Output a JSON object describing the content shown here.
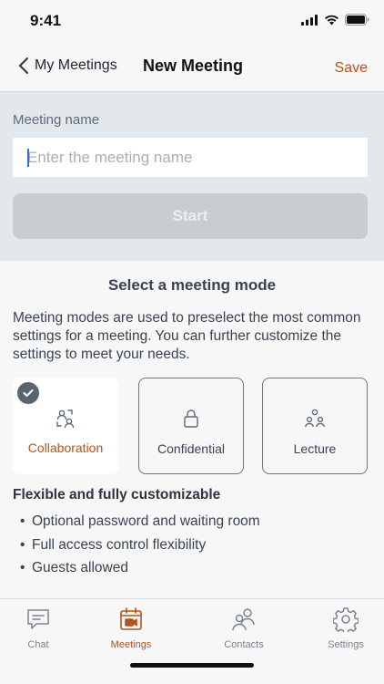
{
  "status_bar": {
    "time": "9:41"
  },
  "nav": {
    "back_label": "My Meetings",
    "title": "New Meeting",
    "save_label": "Save"
  },
  "meeting_name": {
    "label": "Meeting name",
    "placeholder": "Enter the meeting name",
    "value": "",
    "start_label": "Start"
  },
  "mode_selection": {
    "title": "Select a meeting mode",
    "description": "Meeting modes are used to preselect the most common settings for a meeting. You can further customize the settings to meet your needs.",
    "modes": [
      {
        "label": "Collaboration",
        "icon": "collaboration-icon",
        "selected": true
      },
      {
        "label": "Confidential",
        "icon": "lock-icon",
        "selected": false
      },
      {
        "label": "Lecture",
        "icon": "audience-icon",
        "selected": false
      }
    ],
    "features_title": "Flexible and fully customizable",
    "features": [
      "Optional password and waiting room",
      "Full access control flexibility",
      "Guests allowed"
    ]
  },
  "tab_bar": {
    "tabs": [
      {
        "label": "Chat",
        "icon": "chat-icon",
        "active": false
      },
      {
        "label": "Meetings",
        "icon": "calendar-video-icon",
        "active": true
      },
      {
        "label": "Contacts",
        "icon": "contacts-icon",
        "active": false
      },
      {
        "label": "Settings",
        "icon": "gear-icon",
        "active": false
      }
    ]
  },
  "colors": {
    "accent": "#b1531e",
    "text": "#3a4451",
    "section_bg": "#e3e8ec",
    "disabled_button": "#c9cdd1"
  }
}
